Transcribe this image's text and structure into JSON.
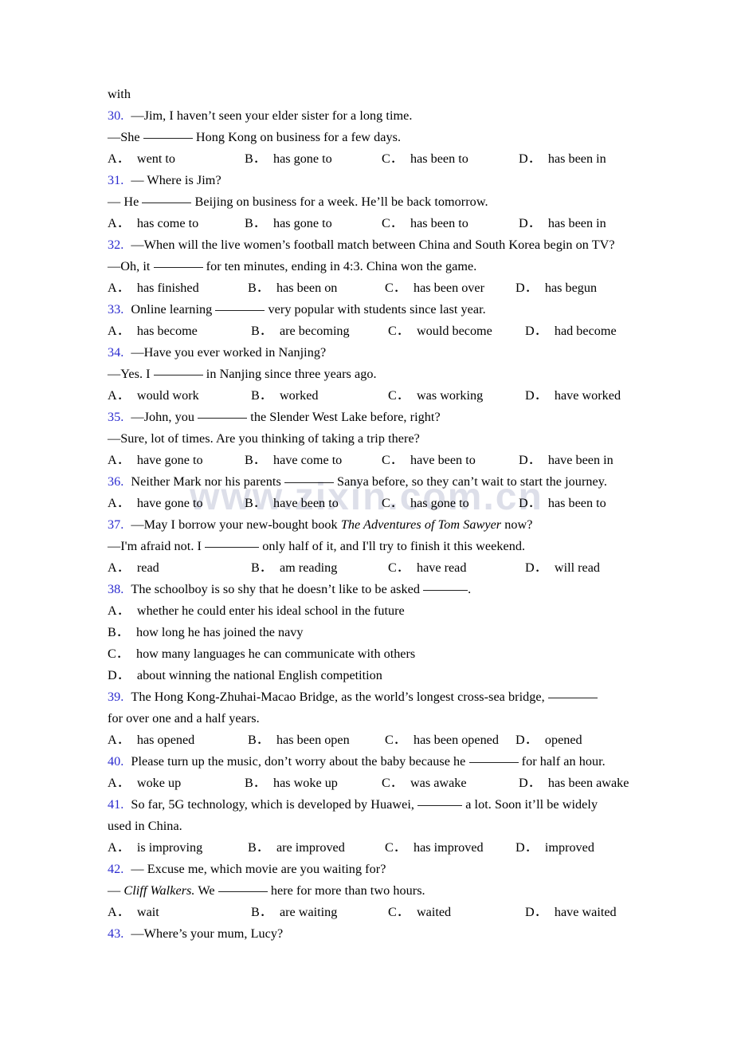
{
  "page": {
    "watermark": "www.zixin.com.cn",
    "number_color": "#2b2bcf",
    "text_color": "#000000",
    "background": "#ffffff",
    "orphan_line": "with"
  },
  "questions": [
    {
      "number": "30.",
      "stem_lines": [
        "—Jim, I haven’t seen your elder sister for a long time.",
        "—She ______ Hong Kong on business for a few days."
      ],
      "options": [
        "went to",
        "has gone to",
        "has been to",
        "has been in"
      ],
      "layout": "row"
    },
    {
      "number": "31.",
      "stem_lines": [
        "— Where is Jim?",
        "— He ______ Beijing on business for a week. He’ll be back tomorrow."
      ],
      "options": [
        "has come to",
        "has gone to",
        "has been to",
        "has been in"
      ],
      "layout": "row"
    },
    {
      "number": "32.",
      "stem_lines": [
        "—When will the live women’s football match between China and South Korea begin on TV?",
        "—Oh, it ______ for ten minutes, ending in 4:3. China won the game."
      ],
      "options": [
        "has finished",
        "has been on",
        "has been over",
        "has begun"
      ],
      "layout": "row"
    },
    {
      "number": "33.",
      "stem_lines": [
        "Online learning ______ very popular with students since last year."
      ],
      "options": [
        "has become",
        "are becoming",
        "would become",
        "had become"
      ],
      "layout": "row"
    },
    {
      "number": "34.",
      "stem_lines": [
        "—Have you ever worked in Nanjing?",
        "—Yes. I ______ in Nanjing since three years ago."
      ],
      "options": [
        "would work",
        "worked",
        "was working",
        "have worked"
      ],
      "layout": "row"
    },
    {
      "number": "35.",
      "stem_lines": [
        "—John, you ______ the Slender West Lake before, right?",
        "—Sure, lot of times. Are you thinking of taking a trip there?"
      ],
      "options": [
        "have gone to",
        "have come to",
        "have been to",
        "have been in"
      ],
      "layout": "row"
    },
    {
      "number": "36.",
      "stem_lines": [
        "Neither Mark nor his parents ______ Sanya before, so they can’t wait to start the journey."
      ],
      "options": [
        "have gone to",
        "have been to",
        "has gone to",
        "has been to"
      ],
      "layout": "row"
    },
    {
      "number": "37.",
      "stem_lines": [
        "—May I borrow your new-bought book The Adventures of Tom Sawyer now?",
        "—I'm afraid not. I ______ only half of it, and I'll try to finish it this weekend."
      ],
      "italic_title": "The Adventures of Tom Sawyer",
      "options": [
        "read",
        "am reading",
        "have read",
        "will read"
      ],
      "layout": "row"
    },
    {
      "number": "38.",
      "stem_lines": [
        "The schoolboy is so shy that he doesn’t like to be asked ______."
      ],
      "options": [
        "whether he could enter his ideal school in the future",
        "how long he has joined the navy",
        "how many languages he can communicate with others",
        "about winning the national English competition"
      ],
      "layout": "stacked"
    },
    {
      "number": "39.",
      "stem_lines": [
        "The Hong Kong-Zhuhai-Macao Bridge, as the world’s longest cross-sea bridge, ______",
        "for over one and a half years."
      ],
      "options": [
        "has opened",
        "has been open",
        "has been opened",
        "opened"
      ],
      "layout": "row"
    },
    {
      "number": "40.",
      "stem_lines": [
        "Please turn up the music, don’t worry about the baby because he ______ for half an hour."
      ],
      "options": [
        "woke up",
        "has woke up",
        "was awake",
        "has been awake"
      ],
      "layout": "row"
    },
    {
      "number": "41.",
      "stem_lines": [
        "So far, 5G technology, which is developed by Huawei, ______ a lot. Soon it’ll be widely",
        "used in China."
      ],
      "options": [
        "is improving",
        "are improved",
        "has improved",
        "improved"
      ],
      "layout": "row"
    },
    {
      "number": "42.",
      "stem_lines": [
        "— Excuse me, which movie are you waiting for?",
        "— Cliff Walkers. We ______ here for more than two hours."
      ],
      "italic_title": "Cliff Walkers",
      "options": [
        "wait",
        "are waiting",
        "waited",
        "have waited"
      ],
      "layout": "row"
    },
    {
      "number": "43.",
      "stem_lines": [
        "—Where’s your mum, Lucy?"
      ],
      "options": [],
      "layout": "row"
    }
  ],
  "option_letters": [
    "A．",
    "B．",
    "C．",
    "D．"
  ],
  "q30": {
    "num": "30.",
    "l1": "—Jim, I haven’t seen your elder sister for a long time.",
    "l2a": "—She",
    "l2b": "Hong Kong on business for a few days.",
    "o": [
      "went to",
      "has gone to",
      "has been to",
      "has been in"
    ]
  },
  "q31": {
    "num": "31.",
    "l1": "— Where is Jim?",
    "l2a": "— He",
    "l2b": "Beijing on business for a week. He’ll be back tomorrow.",
    "o": [
      "has come to",
      "has gone to",
      "has been to",
      "has been in"
    ]
  },
  "q32": {
    "num": "32.",
    "l1": "—When will the live women’s football match between China and South Korea begin on TV?",
    "l2a": "—Oh, it",
    "l2b": "for ten minutes, ending in 4:3. China won the game.",
    "o": [
      "has finished",
      "has been on",
      "has been over",
      "has begun"
    ]
  },
  "q33": {
    "num": "33.",
    "l1a": "Online learning",
    "l1b": "very popular with students since last year.",
    "o": [
      "has become",
      "are becoming",
      "would become",
      "had become"
    ]
  },
  "q34": {
    "num": "34.",
    "l1": "—Have you ever worked in Nanjing?",
    "l2a": "—Yes. I",
    "l2b": "in Nanjing since three years ago.",
    "o": [
      "would work",
      "worked",
      "was working",
      "have worked"
    ]
  },
  "q35": {
    "num": "35.",
    "l1a": "—John, you",
    "l1b": "the Slender West Lake before, right?",
    "l2": "—Sure, lot of times. Are you thinking of taking a trip there?",
    "o": [
      "have gone to",
      "have come to",
      "have been to",
      "have been in"
    ]
  },
  "q36": {
    "num": "36.",
    "l1a": "Neither Mark nor his parents",
    "l1b": "Sanya before, so they can’t wait to start the journey.",
    "o": [
      "have gone to",
      "have been to",
      "has gone to",
      "has been to"
    ]
  },
  "q37": {
    "num": "37.",
    "l1a": "—May I borrow your new-bought book",
    "l1i": "The Adventures of Tom Sawyer",
    "l1b": "now?",
    "l2a": "—I'm afraid not. I",
    "l2b": "only half of it, and I'll try to finish it this weekend.",
    "o": [
      "read",
      "am reading",
      "have read",
      "will read"
    ]
  },
  "q38": {
    "num": "38.",
    "l1a": "The schoolboy is so shy that he doesn’t like to be asked",
    "l1b": ".",
    "o": [
      "whether he could enter his ideal school in the future",
      "how long he has joined the navy",
      "how many languages he can communicate with others",
      "about winning the national English competition"
    ]
  },
  "q39": {
    "num": "39.",
    "l1a": "The Hong Kong-Zhuhai-Macao Bridge, as the world’s longest cross-sea bridge,",
    "l2": "for over one and a half years.",
    "o": [
      "has opened",
      "has been open",
      "has been opened",
      "opened"
    ]
  },
  "q40": {
    "num": "40.",
    "l1a": "Please turn up the music, don’t worry about the baby because he",
    "l1b": "for half an hour.",
    "o": [
      "woke up",
      "has woke up",
      "was awake",
      "has been awake"
    ]
  },
  "q41": {
    "num": "41.",
    "l1a": "So far, 5G technology, which is developed by Huawei,",
    "l1b": "a lot. Soon it’ll be widely",
    "l2": "used in China.",
    "o": [
      "is improving",
      "are improved",
      "has improved",
      "improved"
    ]
  },
  "q42": {
    "num": "42.",
    "l1": "— Excuse me, which movie are you waiting for?",
    "l2a": "—",
    "l2i": "Cliff Walkers.",
    "l2b": "We",
    "l2c": "here for more than two hours.",
    "o": [
      "wait",
      "are waiting",
      "waited",
      "have waited"
    ]
  },
  "q43": {
    "num": "43.",
    "l1": "—Where’s your mum, Lucy?"
  },
  "letters": {
    "a": "A．",
    "b": "B．",
    "c": "C．",
    "d": "D．"
  }
}
